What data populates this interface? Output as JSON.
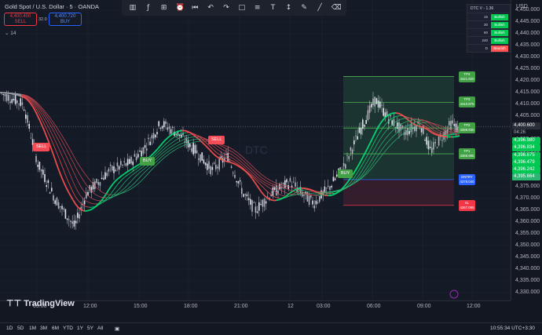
{
  "chart": {
    "title": "Gold Spot / U.S. Dollar · 5 · OANDA",
    "sell_price": "4,400.400",
    "sell_label": "SELL",
    "buy_price": "4,400.720",
    "buy_label": "BUY",
    "spread": "32.0",
    "indicator_count": "14",
    "watermark": "DTC",
    "logo_text": "TradingView",
    "currency": "USD",
    "current_price": "4,400.600",
    "countdown": "04:26"
  },
  "price_axis": [
    "4,450.000",
    "4,445.000",
    "4,440.000",
    "4,435.000",
    "4,430.000",
    "4,425.000",
    "4,420.000",
    "4,415.000",
    "4,410.000",
    "4,405.000",
    "4,400.000",
    "4,395.000",
    "4,390.000",
    "4,385.000",
    "4,380.000",
    "4,375.000",
    "4,370.000",
    "4,365.000",
    "4,360.000",
    "4,355.000",
    "4,350.000",
    "4,345.000",
    "4,340.000",
    "4,335.000",
    "4,330.000"
  ],
  "ma_labels": [
    "4,396.980",
    "4,396.834",
    "4,396.675",
    "4,396.479",
    "4,396.242",
    "4,395.664"
  ],
  "time_axis": [
    "09:00",
    "12:00",
    "15:00",
    "18:00",
    "21:00",
    "12",
    "03:00",
    "06:00",
    "09:00",
    "12:00"
  ],
  "ranges": [
    "1D",
    "5D",
    "1M",
    "3M",
    "6M",
    "YTD",
    "1Y",
    "5Y",
    "All"
  ],
  "clock": "10:55:34 UTC+3:30",
  "dtc_table": {
    "title": "DTC V - 1.36",
    "rows": [
      {
        "tf": "15",
        "status": "Bullish"
      },
      {
        "tf": "30",
        "status": "Bullish"
      },
      {
        "tf": "60",
        "status": "Bullish"
      },
      {
        "tf": "240",
        "status": "Bullish"
      },
      {
        "tf": "D",
        "status": "Bearish"
      }
    ]
  },
  "levels": {
    "tp4": {
      "label": "TP4",
      "value": "4421.820"
    },
    "tp3": {
      "label": "TP3",
      "value": "4410.875"
    },
    "tp2": {
      "label": "TP2",
      "value": "4399.930"
    },
    "tp1": {
      "label": "TP1",
      "value": "4388.985"
    },
    "entry": {
      "label": "ENTRY",
      "value": "4378.040"
    },
    "sl": {
      "label": "SL",
      "value": "4367.095"
    }
  },
  "signals": [
    {
      "label": "SELL",
      "type": "sell"
    },
    {
      "label": "BUY",
      "type": "buy"
    },
    {
      "label": "SELL",
      "type": "sell"
    },
    {
      "label": "BUY",
      "type": "buy"
    }
  ],
  "colors": {
    "bull": "#22ab94",
    "bear": "#f23645",
    "bull_bright": "#4caf50",
    "entry": "#2962ff"
  },
  "toolbar_icons": [
    "candles-icon",
    "indicators-icon",
    "templates-icon",
    "alert-icon",
    "replay-icon",
    "undo-icon",
    "redo-icon",
    "rectangle-icon",
    "fib-icon",
    "text-icon",
    "measure-icon",
    "brush-icon",
    "trend-line-icon",
    "eraser-icon"
  ]
}
